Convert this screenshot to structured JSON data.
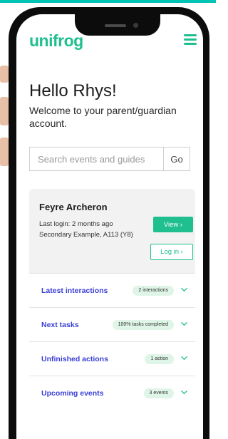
{
  "brand": {
    "logo_text": "unifrog",
    "accent": "#1fbf8f",
    "link_color": "#3a3fd4"
  },
  "header": {
    "greeting": "Hello Rhys!",
    "welcome": "Welcome to your parent/guardian account."
  },
  "search": {
    "placeholder": "Search events and guides",
    "button_label": "Go"
  },
  "student": {
    "name": "Feyre Archeron",
    "last_login": "Last login: 2 months ago",
    "school": "Secondary Example, A113 (Y8)",
    "view_label": "View ›",
    "login_label": "Log in ›"
  },
  "sections": [
    {
      "label": "Latest interactions",
      "badge": "2 interactions"
    },
    {
      "label": "Next tasks",
      "badge": "100% tasks completed"
    },
    {
      "label": "Unfinished actions",
      "badge": "1 action"
    },
    {
      "label": "Upcoming events",
      "badge": "3 events"
    }
  ],
  "icons": {
    "menu": "hamburger-menu-icon",
    "chevron": "chevron-down-icon"
  }
}
